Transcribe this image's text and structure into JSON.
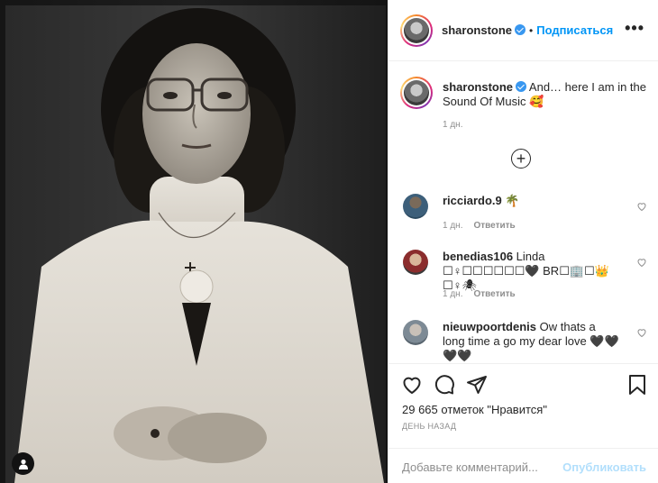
{
  "photo": {
    "alt": "",
    "tag_icon": "user-tag-icon"
  },
  "header": {
    "username": "sharonstone",
    "separator": "•",
    "follow_label": "Подписаться",
    "more_label": "•••"
  },
  "caption": {
    "username": "sharonstone",
    "text": "And… here I am in the Sound Of Music 🥰",
    "time": "1 дн."
  },
  "load_more_icon": "plus-circle-icon",
  "comments": [
    {
      "username": "ricciardo.9",
      "text": "🌴",
      "time": "1 дн.",
      "reply": "Ответить"
    },
    {
      "username": "benedias106",
      "text": "Linda ☐♀☐☐☐☐☐☐🖤 BR☐🏢☐👑☐♀🕷",
      "time": "1 дн.",
      "reply": "Ответить"
    },
    {
      "username": "nieuwpoortdenis",
      "text": "Ow thats a long time a go my dear love 🖤🖤🖤🖤",
      "time": "",
      "reply": ""
    }
  ],
  "actions": {
    "like_icon": "heart-icon",
    "comment_icon": "comment-icon",
    "share_icon": "paper-plane-icon",
    "save_icon": "bookmark-icon",
    "likes_text": "29 665 отметок \"Нравится\"",
    "post_time": "ДЕНЬ НАЗАД"
  },
  "add_comment": {
    "placeholder": "Добавьте комментарий...",
    "publish_label": "Опубликовать"
  },
  "colors": {
    "accent": "#0095f6",
    "verified": "#3897f0",
    "muted": "#8e8e8e"
  }
}
